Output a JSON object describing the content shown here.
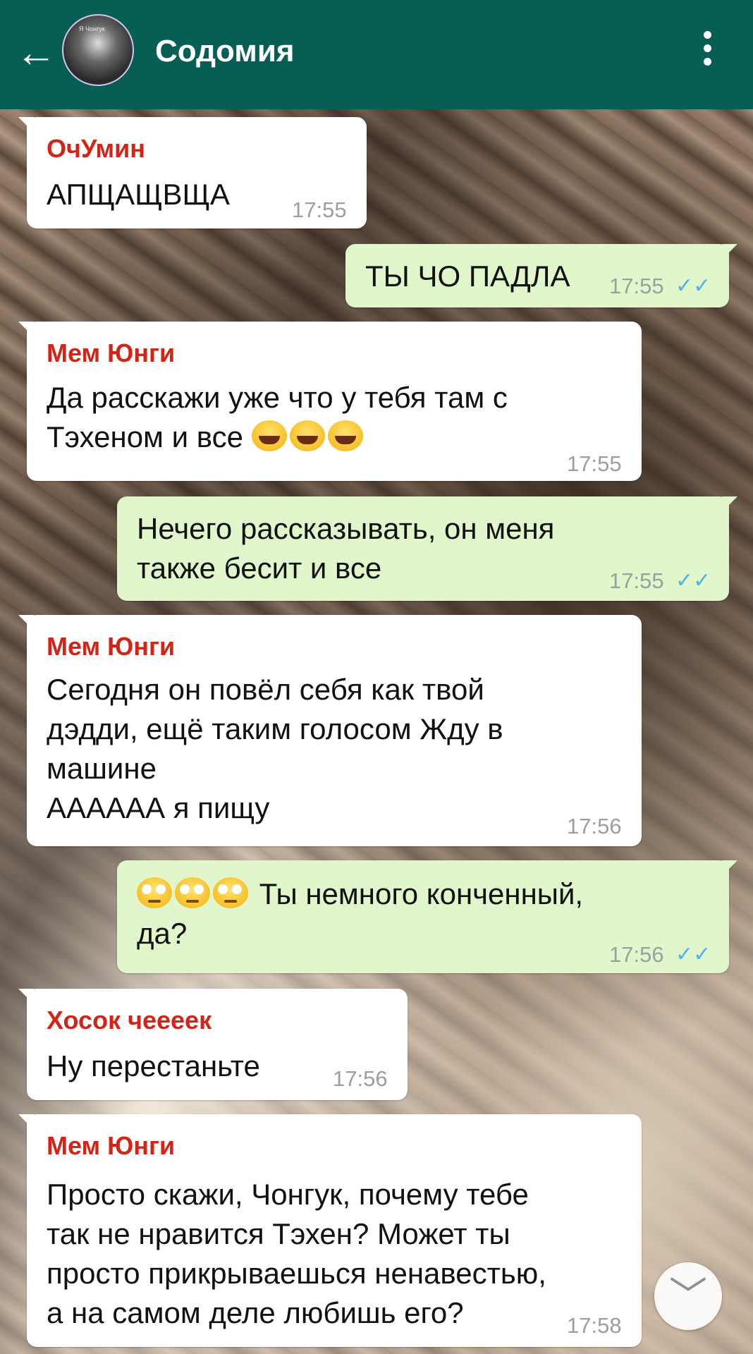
{
  "header": {
    "title": "Содомия",
    "back_icon": "arrow-left-icon",
    "menu_icon": "more-vert-icon",
    "avatar_caption": "Я Чонгук"
  },
  "colors": {
    "header_bg": "#075e54",
    "incoming_bubble": "#ffffff",
    "outgoing_bubble": "#e1f6cb",
    "sender_name": "#d42417",
    "read_ticks": "#4fb3e6"
  },
  "messages": [
    {
      "dir": "in",
      "sender": "ОчУмин",
      "text": "АПЩАЩВЩА",
      "time": "17:55"
    },
    {
      "dir": "out",
      "text": "ТЫ ЧО ПАДЛА",
      "time": "17:55",
      "status": "read"
    },
    {
      "dir": "in",
      "sender": "Мем Юнги",
      "text": "Да расскажи уже что у тебя там с\nТэхеном и все",
      "emoji": "😂😂😂",
      "time": "17:55"
    },
    {
      "dir": "out",
      "text": "Нечего рассказывать, он меня\nтакже бесит и все",
      "time": "17:55",
      "status": "read"
    },
    {
      "dir": "in",
      "sender": "Мем Юнги",
      "text": "Сегодня он повёл себя как твой\nдэдди, ещё таким голосом Жду в\nмашине\nАААААА я пищу",
      "time": "17:56"
    },
    {
      "dir": "out",
      "emoji": "🙄🙄🙄",
      "text": " Ты немного конченный,\nда?",
      "time": "17:56",
      "status": "read"
    },
    {
      "dir": "in",
      "sender": "Хосок чееeек",
      "text": "Ну перестаньте",
      "time": "17:56"
    },
    {
      "dir": "in",
      "sender": "Мем Юнги",
      "text": "Просто скажи, Чонгук, почему тебе\nтак не нравится Тэхен? Может ты\nпросто прикрываешься ненавестью,\nа на самом деле любишь его?",
      "time": "17:58"
    }
  ],
  "read_ticks_glyph": "✓✓",
  "scroll_down_glyph": "﹀"
}
